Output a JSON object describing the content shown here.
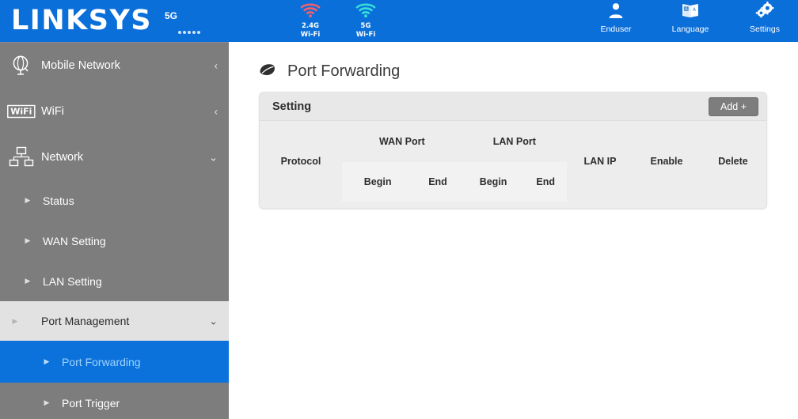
{
  "header": {
    "brand": "LINKSYS",
    "mobile_signal": {
      "label": "5G",
      "bars": 5
    },
    "wifi": [
      {
        "icon": "wifi-icon",
        "line1": "2.4G",
        "line2": "Wi-Fi",
        "color": "#f2616b"
      },
      {
        "icon": "wifi-icon",
        "line1": "5G",
        "line2": "Wi-Fi",
        "color": "#35e0d8"
      }
    ],
    "account": [
      {
        "icon": "user-icon",
        "label": "Enduser"
      },
      {
        "icon": "language-book-icon",
        "label": "Language"
      },
      {
        "icon": "gear-icon",
        "label": "Settings"
      }
    ]
  },
  "sidebar": {
    "items": [
      {
        "icon": "globe-icon",
        "label": "Mobile Network",
        "chevron": "‹",
        "expanded": false
      },
      {
        "icon": "wifi-badge-icon",
        "label": "WiFi",
        "chevron": "‹",
        "expanded": false
      },
      {
        "icon": "network-nodes-icon",
        "label": "Network",
        "chevron": "⌄",
        "expanded": true
      }
    ],
    "sub_items": [
      {
        "label": "Status",
        "arrow": "▶",
        "state": "normal"
      },
      {
        "label": "WAN Setting",
        "arrow": "▶",
        "state": "normal"
      },
      {
        "label": "LAN Setting",
        "arrow": "▶",
        "state": "normal"
      },
      {
        "label": "Port Management",
        "arrow": "▶",
        "state": "group",
        "chevron": "⌄"
      },
      {
        "label": "Port Forwarding",
        "arrow": "▶",
        "state": "active"
      },
      {
        "label": "Port Trigger",
        "arrow": "▶",
        "state": "nested"
      }
    ]
  },
  "main": {
    "page_icon": "leaf-icon",
    "page_title": "Port Forwarding",
    "panel": {
      "heading": "Setting",
      "add_label": "Add +"
    },
    "table": {
      "headers": {
        "protocol": "Protocol",
        "wan_port": "WAN Port",
        "lan_port": "LAN Port",
        "lan_ip": "LAN IP",
        "enable": "Enable",
        "delete": "Delete"
      },
      "sub_headers": {
        "wan_begin": "Begin",
        "wan_end": "End",
        "lan_begin": "Begin",
        "lan_end": "End"
      },
      "rows": []
    }
  },
  "colors": {
    "header_blue": "#0b6fd9",
    "active_blue": "#0b72dc",
    "sidebar_gray": "#7d7d7d",
    "panel_gray": "#ededed",
    "accent_text": "#9ed3ff"
  }
}
